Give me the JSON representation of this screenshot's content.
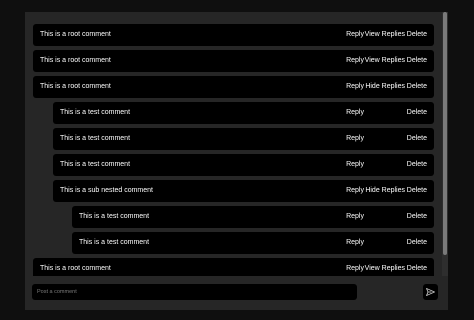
{
  "comments": [
    {
      "text": "This is a root comment",
      "reply": "Reply",
      "toggle": "View Replies",
      "delete": "Delete"
    },
    {
      "text": "This is a root comment",
      "reply": "Reply",
      "toggle": "View Replies",
      "delete": "Delete"
    },
    {
      "text": "This is a root comment",
      "reply": "Reply",
      "toggle": "Hide Replies",
      "delete": "Delete"
    },
    {
      "text": "This is a test comment",
      "reply": "Reply",
      "delete": "Delete"
    },
    {
      "text": "This is a test comment",
      "reply": "Reply",
      "delete": "Delete"
    },
    {
      "text": "This is a test comment",
      "reply": "Reply",
      "delete": "Delete"
    },
    {
      "text": "This is a sub nested comment",
      "reply": "Reply",
      "toggle": "Hide Replies",
      "delete": "Delete"
    },
    {
      "text": "This is a test comment",
      "reply": "Reply",
      "delete": "Delete"
    },
    {
      "text": "This is a test comment",
      "reply": "Reply",
      "delete": "Delete"
    },
    {
      "text": "This is a root comment",
      "reply": "Reply",
      "toggle": "View Replies",
      "delete": "Delete"
    }
  ],
  "composer": {
    "placeholder": "Post a comment",
    "send_icon": "send-icon"
  }
}
